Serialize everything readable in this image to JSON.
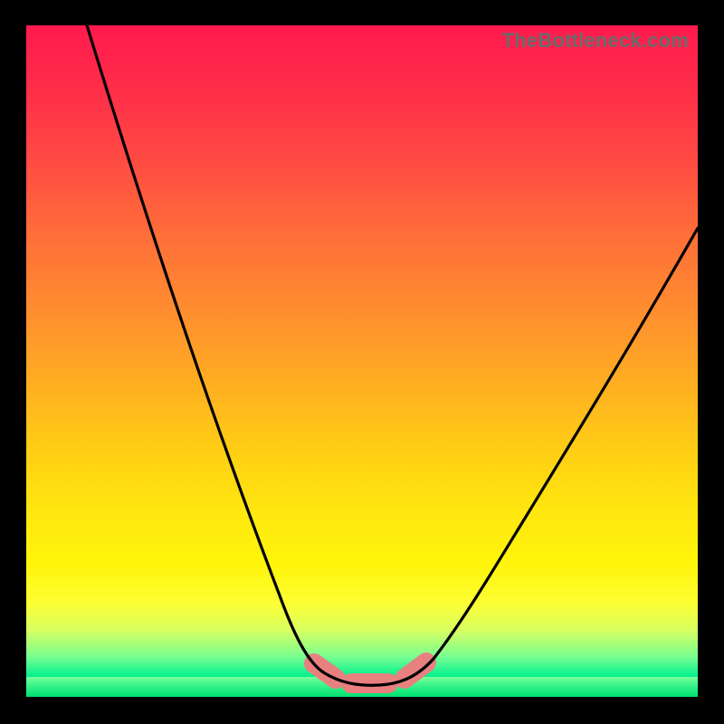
{
  "watermark": "TheBottleneck.com",
  "chart_data": {
    "type": "line",
    "title": "",
    "xlabel": "",
    "ylabel": "",
    "xlim": [
      0,
      100
    ],
    "ylim": [
      0,
      100
    ],
    "series": [
      {
        "name": "bottleneck_curve",
        "x": [
          9,
          14.8,
          20.7,
          26.5,
          32.3,
          38.2,
          42.0,
          44.0,
          47.0,
          50.0,
          53.0,
          56.0,
          59.0,
          63.0,
          68.0,
          75.0,
          82.5,
          90.0,
          97.0,
          100.0
        ],
        "y": [
          100,
          85.0,
          68.0,
          50.0,
          33.0,
          17.0,
          7.0,
          3.0,
          1.5,
          1.0,
          1.5,
          3.0,
          7.0,
          13.0,
          22.0,
          34.0,
          47.0,
          58.0,
          66.5,
          70.0
        ]
      }
    ],
    "marker_color": "#e98080",
    "gradient_colors": {
      "top": "#ff1a4d",
      "mid": "#ffe610",
      "bottom": "#00e070"
    }
  }
}
